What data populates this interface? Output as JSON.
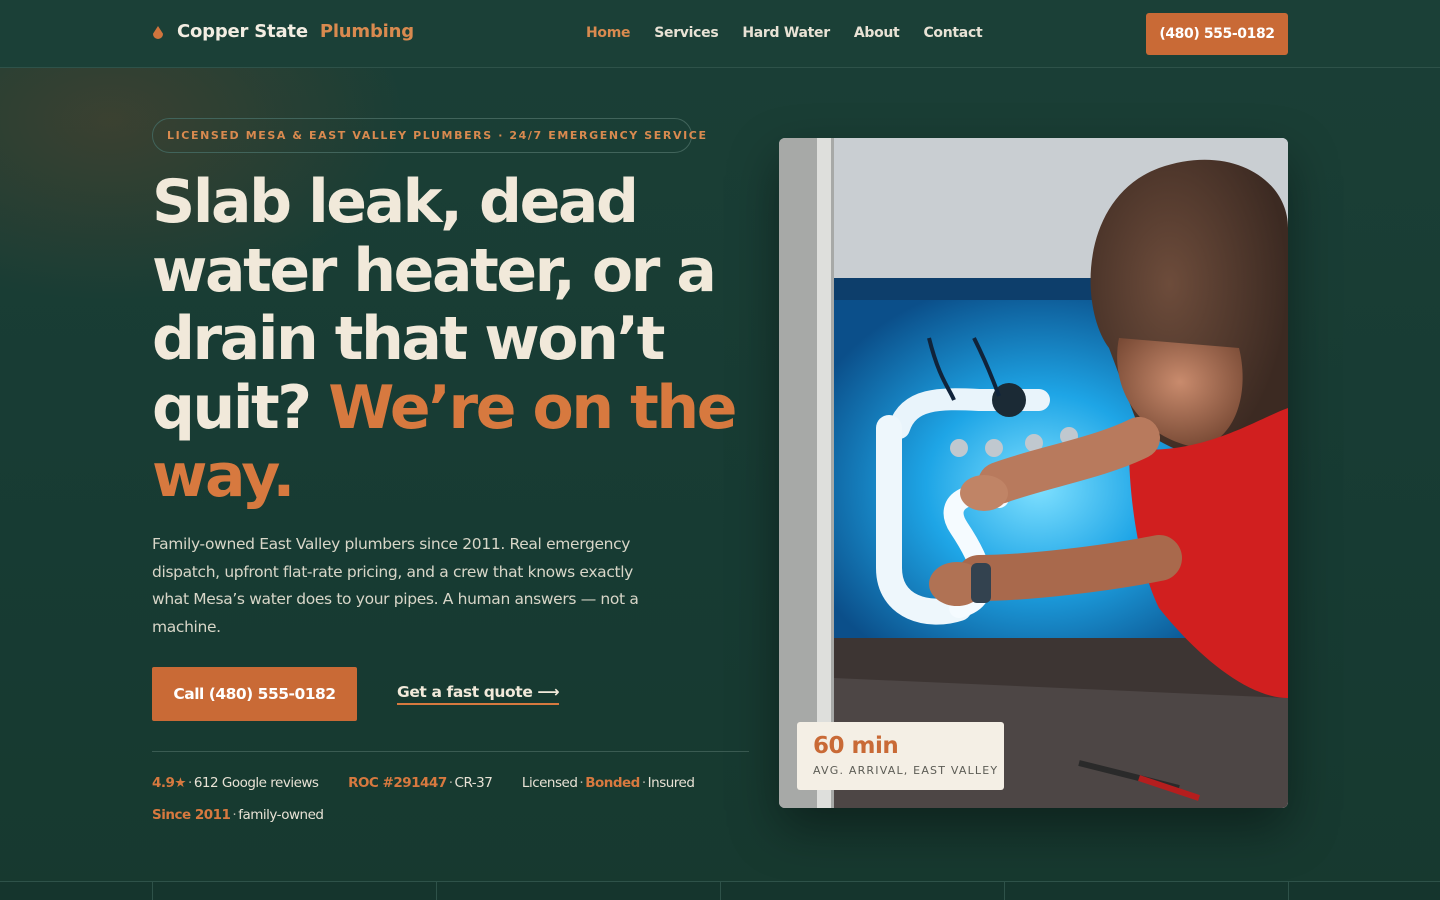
{
  "header": {
    "brand_part1": "Copper State",
    "brand_part2": "Plumbing",
    "nav": [
      "Home",
      "Services",
      "Hard Water",
      "About",
      "Contact"
    ],
    "active_nav": "Home",
    "phone_button": "(480) 555-0182"
  },
  "hero": {
    "eyebrow": "LICENSED MESA & EAST VALLEY PLUMBERS · 24/7 EMERGENCY SERVICE",
    "headline_plain": "Slab leak, dead water heater, or a drain that won’t quit?",
    "headline_accent": "We’re on the way.",
    "lede": "Family-owned East Valley plumbers since 2011. Real emergency dispatch, upfront flat-rate pricing, and a crew that knows exactly what Mesa’s water does to your pipes. A human answers — not a machine.",
    "cta_primary": "Call (480) 555-0182",
    "cta_secondary": "Get a fast quote ⟶"
  },
  "trust": {
    "rating": "4.9★",
    "reviews": "612 Google reviews",
    "roc": "ROC #291447",
    "roc_class": "CR-37",
    "licensed": "Licensed",
    "bonded": "Bonded",
    "insured": "Insured",
    "since": "Since 2011",
    "family": "family-owned"
  },
  "stat": {
    "value": "60 min",
    "label": "AVG. ARRIVAL, EAST VALLEY"
  },
  "colors": {
    "background": "#173d35",
    "accent": "#c96a36",
    "accent_text": "#d7793f",
    "cream": "#f1e9da"
  }
}
